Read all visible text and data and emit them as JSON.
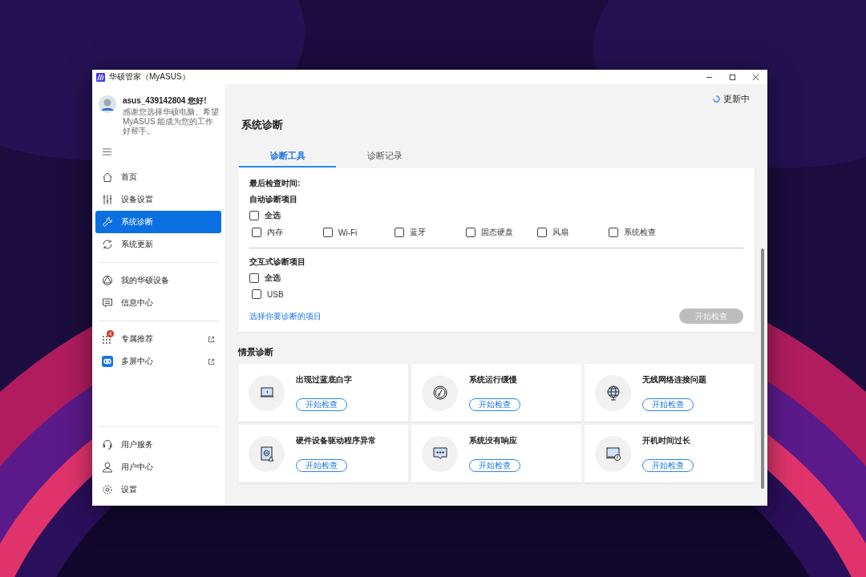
{
  "window": {
    "title": "华硕管家（MyASUS）"
  },
  "user": {
    "greeting": "asus_439142804 您好!",
    "message": "感谢您选择华硕电脑。希望 MyASUS 能成为您的工作好帮手。"
  },
  "nav": [
    [
      {
        "label": "首页",
        "selected": false
      },
      {
        "label": "设备设置",
        "selected": false
      },
      {
        "label": "系统诊断",
        "selected": true
      },
      {
        "label": "系统更新",
        "selected": false
      }
    ],
    [
      {
        "label": "我的华硕设备",
        "selected": false
      },
      {
        "label": "信息中心",
        "selected": false
      }
    ],
    [
      {
        "label": "专属推荐",
        "selected": false,
        "external": true,
        "badge": "4"
      },
      {
        "label": "多屏中心",
        "selected": false,
        "external": true
      }
    ],
    [
      {
        "label": "用户服务",
        "selected": false
      },
      {
        "label": "用户中心",
        "selected": false
      },
      {
        "label": "设置",
        "selected": false
      }
    ]
  ],
  "status": "更新中",
  "page_title": "系统诊断",
  "tabs": [
    {
      "label": "诊断工具",
      "selected": true
    },
    {
      "label": "诊断记录",
      "selected": false
    }
  ],
  "diagnostics": {
    "last_check_label": "最后检查时间:",
    "groups": [
      {
        "title": "自动诊断项目",
        "select_all": {
          "label": "全选",
          "checked": false
        },
        "items": [
          {
            "label": "内存",
            "checked": false
          },
          {
            "label": "Wi-Fi",
            "checked": false
          },
          {
            "label": "蓝牙",
            "checked": false
          },
          {
            "label": "固态硬盘",
            "checked": false
          },
          {
            "label": "风扇",
            "checked": false
          },
          {
            "label": "系统检查",
            "checked": false
          }
        ]
      },
      {
        "title": "交互式诊断项目",
        "select_all": {
          "label": "全选",
          "checked": false
        },
        "items": [
          {
            "label": "USB",
            "checked": false
          }
        ]
      }
    ],
    "link": "选择你要诊断的项目",
    "start_button": {
      "label": "开始检查",
      "disabled": true
    }
  },
  "scenario": {
    "title": "情景诊断",
    "cards": [
      {
        "title": "出现过蓝底白字",
        "button": "开始检查"
      },
      {
        "title": "系统运行缓慢",
        "button": "开始检查"
      },
      {
        "title": "无线网络连接问题",
        "button": "开始检查"
      },
      {
        "title": "硬件设备驱动程序异常",
        "button": "开始检查"
      },
      {
        "title": "系统没有响应",
        "button": "开始检查"
      },
      {
        "title": "开机时间过长",
        "button": "开始检查"
      }
    ]
  }
}
